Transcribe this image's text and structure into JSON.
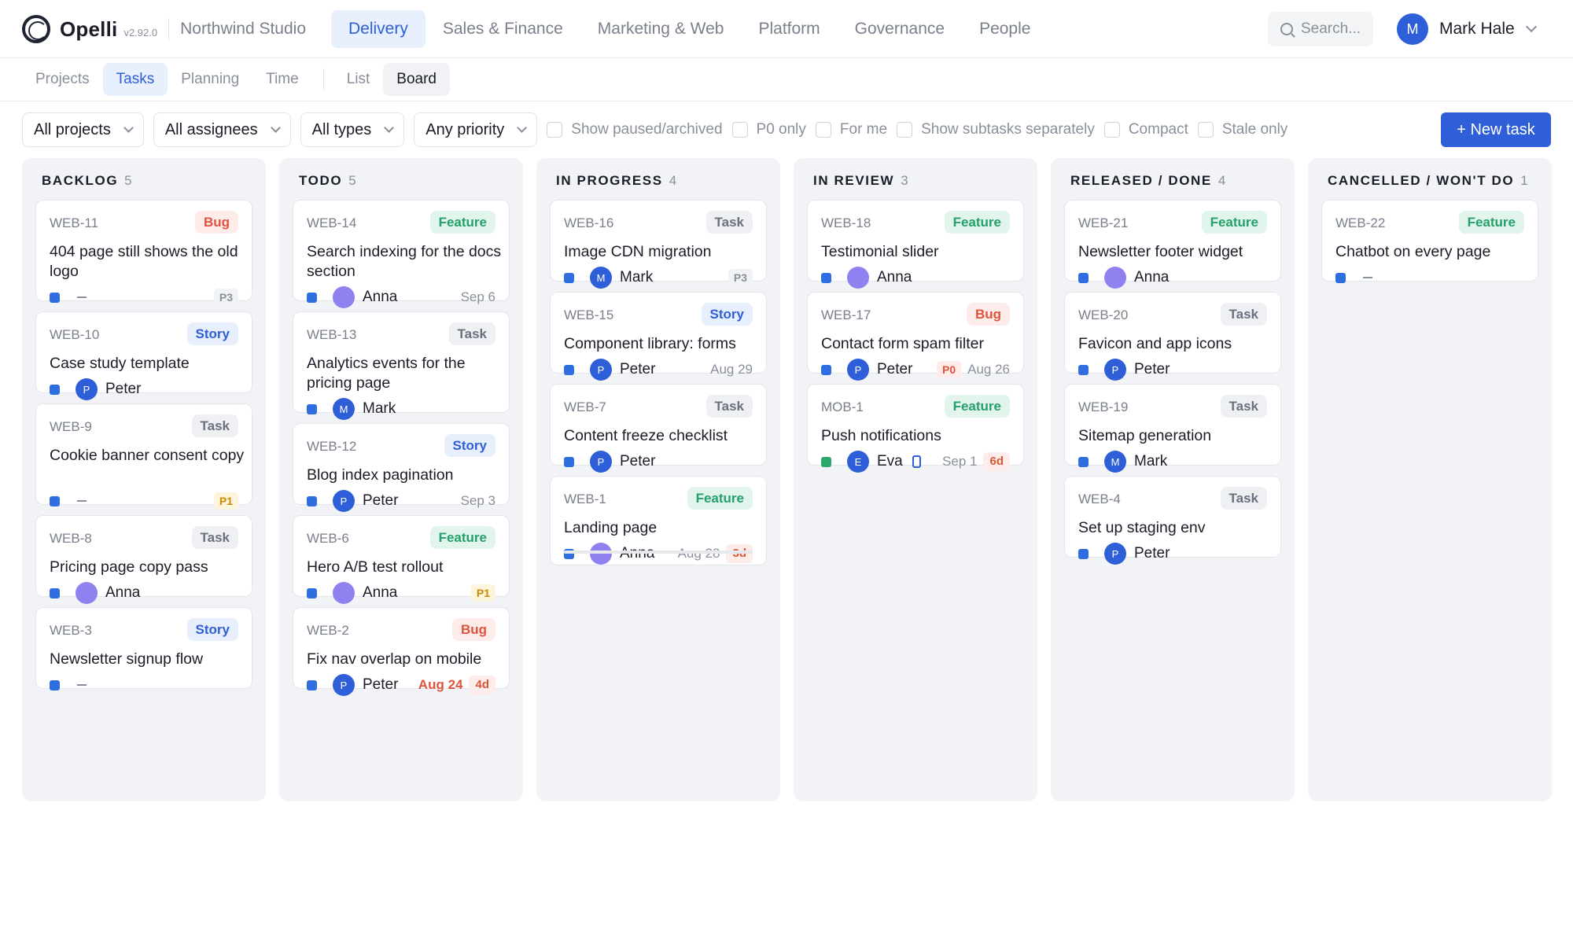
{
  "brand": {
    "name": "Opelli",
    "version": "v2.92.0",
    "org": "Northwind Studio"
  },
  "nav": {
    "items": [
      "Delivery",
      "Sales & Finance",
      "Marketing & Web",
      "Platform",
      "Governance",
      "People"
    ],
    "active": "Delivery"
  },
  "search": {
    "placeholder": "Search..."
  },
  "user": {
    "initial": "M",
    "name": "Mark Hale"
  },
  "subnav": {
    "tabs": [
      "Projects",
      "Tasks",
      "Planning",
      "Time"
    ],
    "active_tab": "Tasks",
    "views": [
      "List",
      "Board"
    ],
    "active_view": "Board"
  },
  "filters": {
    "selects": [
      "All projects",
      "All assignees",
      "All types",
      "Any priority"
    ],
    "toggles": [
      "Show paused/archived",
      "P0 only",
      "For me",
      "Show subtasks separately",
      "Compact",
      "Stale only"
    ]
  },
  "new_task_label": "+ New task",
  "colors": {
    "accent": "#2f5fd8",
    "bug": "#e0533d",
    "story": "#2f5fd8",
    "task": "#6b7080",
    "feature": "#24a06b"
  },
  "columns": [
    {
      "title": "BACKLOG",
      "count": "5",
      "cards": [
        {
          "id": "WEB-11",
          "type": "Bug",
          "title": "404 page still shows the old logo",
          "assignee": "",
          "initial": "",
          "priority": "P3",
          "due": "",
          "age": ""
        },
        {
          "id": "WEB-10",
          "type": "Story",
          "title": "Case study template",
          "assignee": "Peter",
          "initial": "P",
          "priority": "",
          "due": "",
          "age": ""
        },
        {
          "id": "WEB-9",
          "type": "Task",
          "title": "Cookie banner consent copy",
          "assignee": "",
          "initial": "",
          "priority": "P1",
          "due": "",
          "age": ""
        },
        {
          "id": "WEB-8",
          "type": "Task",
          "title": "Pricing page copy pass",
          "assignee": "Anna",
          "initial": "",
          "priority": "",
          "due": "",
          "age": ""
        },
        {
          "id": "WEB-3",
          "type": "Story",
          "title": "Newsletter signup flow",
          "assignee": "",
          "initial": "",
          "priority": "",
          "due": "",
          "age": ""
        }
      ]
    },
    {
      "title": "TODO",
      "count": "5",
      "cards": [
        {
          "id": "WEB-14",
          "type": "Feature",
          "title": "Search indexing for the docs section",
          "assignee": "Anna",
          "initial": "",
          "priority": "",
          "due": "Sep 6",
          "age": ""
        },
        {
          "id": "WEB-13",
          "type": "Task",
          "title": "Analytics events for the pricing page",
          "assignee": "Mark",
          "initial": "M",
          "priority": "",
          "due": "",
          "age": ""
        },
        {
          "id": "WEB-12",
          "type": "Story",
          "title": "Blog index pagination",
          "assignee": "Peter",
          "initial": "P",
          "priority": "",
          "due": "Sep 3",
          "age": ""
        },
        {
          "id": "WEB-6",
          "type": "Feature",
          "title": "Hero A/B test rollout",
          "assignee": "Anna",
          "initial": "",
          "priority": "P1",
          "due": "",
          "age": ""
        },
        {
          "id": "WEB-2",
          "type": "Bug",
          "title": "Fix nav overlap on mobile",
          "assignee": "Peter",
          "initial": "P",
          "priority": "",
          "due": "Aug 24",
          "age": "4d",
          "overdue": true
        }
      ]
    },
    {
      "title": "IN PROGRESS",
      "count": "4",
      "cards": [
        {
          "id": "WEB-16",
          "type": "Task",
          "title": "Image CDN migration",
          "assignee": "Mark",
          "initial": "M",
          "priority": "P3",
          "due": "",
          "age": ""
        },
        {
          "id": "WEB-15",
          "type": "Story",
          "title": "Component library: forms",
          "assignee": "Peter",
          "initial": "P",
          "priority": "",
          "due": "Aug 29",
          "age": ""
        },
        {
          "id": "WEB-7",
          "type": "Task",
          "title": "Content freeze checklist",
          "assignee": "Peter",
          "initial": "P",
          "priority": "",
          "due": "",
          "age": ""
        },
        {
          "id": "WEB-1",
          "type": "Feature",
          "title": "Landing page",
          "assignee": "Anna",
          "initial": "",
          "priority": "",
          "due": "Aug 28",
          "age": "3d",
          "progress": 0
        }
      ]
    },
    {
      "title": "IN REVIEW",
      "count": "3",
      "cards": [
        {
          "id": "WEB-18",
          "type": "Feature",
          "title": "Testimonial slider",
          "assignee": "Anna",
          "initial": "",
          "priority": "",
          "due": "",
          "age": ""
        },
        {
          "id": "WEB-17",
          "type": "Bug",
          "title": "Contact form spam filter",
          "assignee": "Peter",
          "initial": "P",
          "priority": "P0",
          "due": "Aug 26",
          "age": ""
        },
        {
          "id": "MOB-1",
          "type": "Feature",
          "title": "Push notifications",
          "assignee": "Eva",
          "initial": "E",
          "priority": "",
          "due": "Sep 1",
          "age": "6d",
          "mobile": true,
          "status": "green"
        }
      ]
    },
    {
      "title": "RELEASED / DONE",
      "count": "4",
      "cards": [
        {
          "id": "WEB-21",
          "type": "Feature",
          "title": "Newsletter footer widget",
          "assignee": "Anna",
          "initial": "",
          "priority": "",
          "due": "",
          "age": ""
        },
        {
          "id": "WEB-20",
          "type": "Task",
          "title": "Favicon and app icons",
          "assignee": "Peter",
          "initial": "P",
          "priority": "",
          "due": "",
          "age": ""
        },
        {
          "id": "WEB-19",
          "type": "Task",
          "title": "Sitemap generation",
          "assignee": "Mark",
          "initial": "M",
          "priority": "",
          "due": "",
          "age": ""
        },
        {
          "id": "WEB-4",
          "type": "Task",
          "title": "Set up staging env",
          "assignee": "Peter",
          "initial": "P",
          "priority": "",
          "due": "",
          "age": ""
        }
      ]
    },
    {
      "title": "CANCELLED / WON'T DO",
      "count": "1",
      "cards": [
        {
          "id": "WEB-22",
          "type": "Feature",
          "title": "Chatbot on every page",
          "assignee": "",
          "initial": "",
          "priority": "",
          "due": "",
          "age": ""
        }
      ]
    }
  ]
}
